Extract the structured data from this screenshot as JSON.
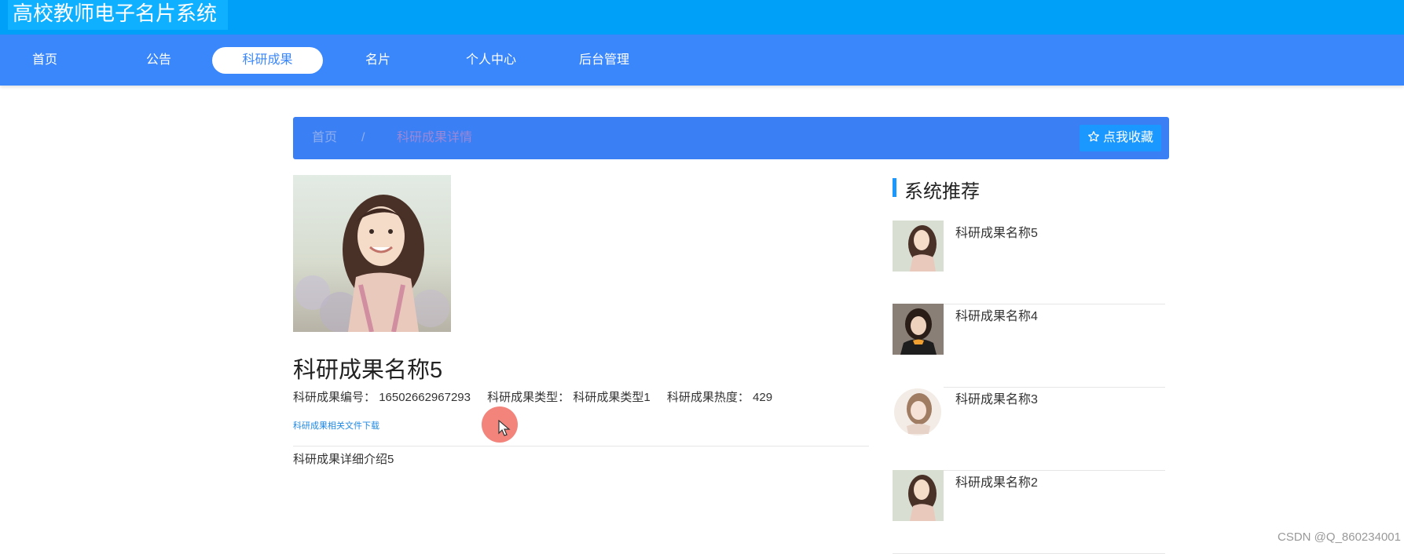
{
  "app": {
    "title": "高校教师电子名片系统"
  },
  "nav": {
    "items": [
      {
        "label": "首页"
      },
      {
        "label": "公告"
      },
      {
        "label": "科研成果",
        "active": true
      },
      {
        "label": "名片"
      },
      {
        "label": "个人中心"
      },
      {
        "label": "后台管理"
      }
    ]
  },
  "breadcrumb": {
    "home": "首页",
    "separator": "/",
    "current": "科研成果详情",
    "favorite_label": "点我收藏",
    "favorite_icon": "star-outline-icon"
  },
  "detail": {
    "image_icon": "portrait-photo",
    "title": "科研成果名称5",
    "meta": {
      "number_label": "科研成果编号：",
      "number_value": "16502662967293",
      "type_label": "科研成果类型：",
      "type_value": "科研成果类型1",
      "heat_label": "科研成果热度：",
      "heat_value": "429"
    },
    "download_label": "科研成果相关文件下载",
    "intro": "科研成果详细介绍5"
  },
  "recommend": {
    "title": "系统推荐",
    "items": [
      {
        "name": "科研成果名称5"
      },
      {
        "name": "科研成果名称4"
      },
      {
        "name": "科研成果名称3"
      },
      {
        "name": "科研成果名称2"
      }
    ]
  },
  "watermark": "CSDN @Q_860234001",
  "colors": {
    "topbar": "#00a0f9",
    "navbar": "#3a86fb",
    "breadcrumb_bar": "#3a7ff4",
    "accent": "#1a98ff"
  }
}
